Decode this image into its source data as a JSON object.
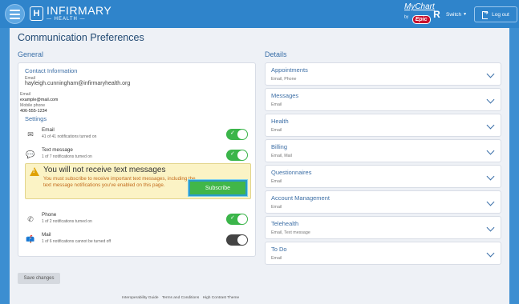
{
  "header": {
    "brand_top": "INFIRMARY",
    "brand_bottom": "— HEALTH —",
    "mychart": "MyChart",
    "by": "by",
    "epic": "Epic",
    "avatar_initial": "R",
    "switch_label": "Switch",
    "logout_label": "Log out"
  },
  "page": {
    "title": "Communication Preferences"
  },
  "general": {
    "section_label": "General",
    "contact": {
      "title": "Contact Information",
      "email_label1": "Email",
      "email_value1": "hayleigh.cunningham@infirmaryhealth.org",
      "email_label2": "Email",
      "email_value2": "example@mail.com",
      "phone_label": "Mobile phone",
      "phone_value": "406-555-1234"
    },
    "settings_title": "Settings",
    "rows": [
      {
        "name": "Email",
        "sub": "41 of 41 notifications turned on",
        "icon": "envelope-icon",
        "state": "on"
      },
      {
        "name": "Text message",
        "sub": "1 of 7 notifications turned on",
        "icon": "chat-icon",
        "state": "on"
      },
      {
        "name": "Phone",
        "sub": "1 of 2 notifications turned on",
        "icon": "phone-icon",
        "state": "on"
      },
      {
        "name": "Mail",
        "sub": "1 of 6 notifications cannot be turned off",
        "icon": "mailbox-icon",
        "state": "off"
      }
    ],
    "warning": {
      "title": "You will not receive text messages",
      "body": "You must subscribe to receive important text messages, including the text message notifications you've enabled on this page.",
      "button": "Subscribe"
    }
  },
  "details": {
    "section_label": "Details",
    "items": [
      {
        "title": "Appointments",
        "sub": "Email, Phone"
      },
      {
        "title": "Messages",
        "sub": "Email"
      },
      {
        "title": "Health",
        "sub": "Email"
      },
      {
        "title": "Billing",
        "sub": "Email, Mail"
      },
      {
        "title": "Questionnaires",
        "sub": "Email"
      },
      {
        "title": "Account Management",
        "sub": "Email"
      },
      {
        "title": "Telehealth",
        "sub": "Email, Text message"
      },
      {
        "title": "To Do",
        "sub": "Email"
      }
    ]
  },
  "actions": {
    "save": "Save changes"
  },
  "footer": {
    "link1": "Interoperability Guide",
    "link2": "Terms and Conditions",
    "link3": "High Contrast Theme"
  },
  "colors": {
    "header": "#2f84cb",
    "accent": "#3c6ea5",
    "toggle_on": "#3bb54a",
    "warning_bg": "#fbf3c5",
    "warning_text": "#c26a1b"
  }
}
